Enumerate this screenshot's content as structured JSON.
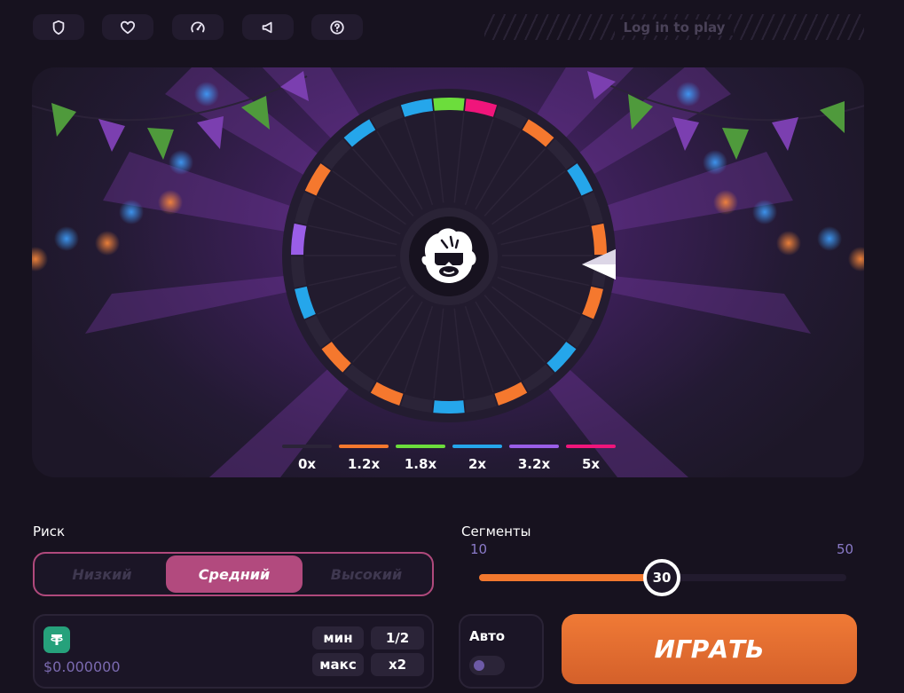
{
  "topbar": {
    "icons": [
      "shield-icon",
      "heart-icon",
      "speedometer-icon",
      "megaphone-icon",
      "help-icon"
    ],
    "login_text": "Log in to play"
  },
  "game": {
    "segments": 30,
    "segment_colors": [
      "#6cdd3c",
      "#f0157b",
      "#2b2438",
      "#f5782e",
      "#2b2438",
      "#25a6eb",
      "#2b2438",
      "#f5782e",
      "#2b2438",
      "#f5782e",
      "#2b2438",
      "#25a6eb",
      "#2b2438",
      "#f5782e",
      "#2b2438",
      "#25a6eb",
      "#2b2438",
      "#f5782e",
      "#2b2438",
      "#f5782e",
      "#2b2438",
      "#25a6eb",
      "#2b2438",
      "#9a5ee8",
      "#2b2438",
      "#f5782e",
      "#2b2438",
      "#25a6eb",
      "#2b2438",
      "#25a6eb"
    ],
    "legend": [
      {
        "color": "#2b2438",
        "label": "0x"
      },
      {
        "color": "#f5782e",
        "label": "1.2x"
      },
      {
        "color": "#6cdd3c",
        "label": "1.8x"
      },
      {
        "color": "#25a6eb",
        "label": "2x"
      },
      {
        "color": "#9a5ee8",
        "label": "3.2x"
      },
      {
        "color": "#f0157b",
        "label": "5x"
      }
    ]
  },
  "risk": {
    "label": "Риск",
    "options": [
      "Низкий",
      "Средний",
      "Высокий"
    ],
    "selected": "Средний"
  },
  "segments_control": {
    "label": "Сегменты",
    "min": "10",
    "max": "50",
    "value": "30"
  },
  "wallet": {
    "currency_icon": "tether-icon",
    "amount": "$0.000000",
    "min_label": "мин",
    "max_label": "макс",
    "half_label": "1/2",
    "double_label": "x2"
  },
  "auto": {
    "label": "Авто",
    "enabled": false
  },
  "play_label": "ИГРАТЬ",
  "colors": {
    "accent": "#f2782e",
    "risk_active": "#b24a7e"
  }
}
